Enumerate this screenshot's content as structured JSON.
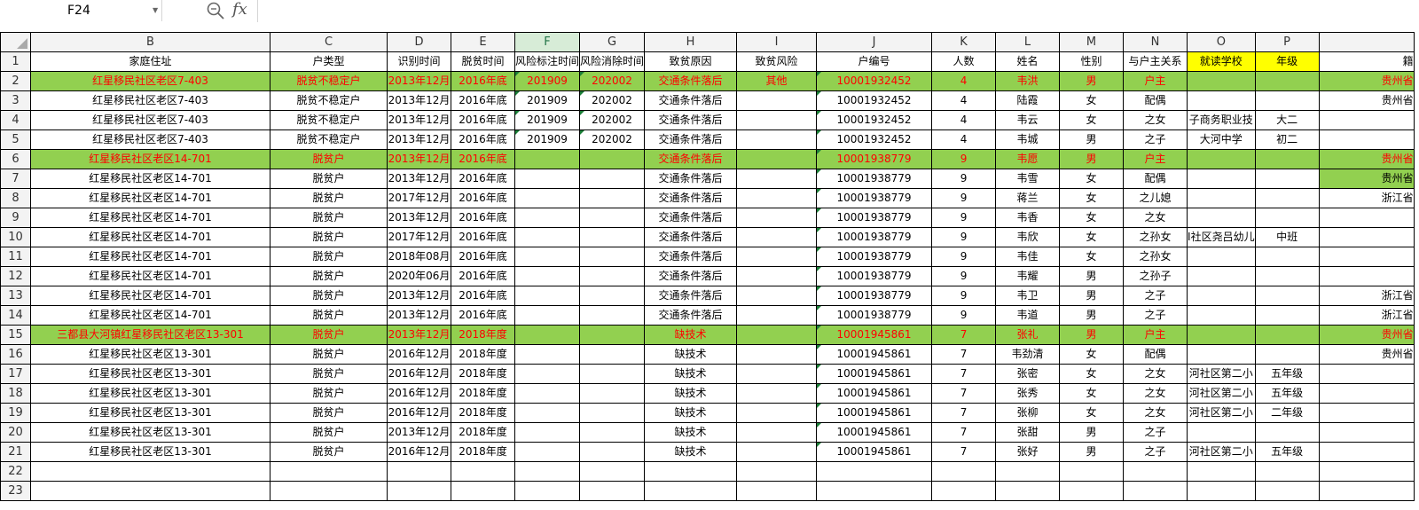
{
  "formula_bar": {
    "cell_ref": "F24",
    "fx_label": "fx",
    "formula": ""
  },
  "columns": [
    "B",
    "C",
    "D",
    "E",
    "F",
    "G",
    "H",
    "I",
    "J",
    "K",
    "L",
    "M",
    "N",
    "O",
    "P",
    ""
  ],
  "header_row": {
    "row": "1",
    "cells": [
      "家庭住址",
      "户类型",
      "识别时间",
      "脱贫时间",
      "风险标注时间",
      "风险消除时间",
      "致贫原因",
      "致贫风险",
      "户编号",
      "人数",
      "姓名",
      "性别",
      "与户主关系",
      "就读学校",
      "年级",
      "籍"
    ]
  },
  "rows": [
    {
      "n": "2",
      "cells": [
        "红星移民社区老区7-403",
        "脱贫不稳定户",
        "2013年12月",
        "2016年底",
        "201909",
        "202002",
        "交通条件落后",
        "其他",
        "10001932452",
        "4",
        "韦洪",
        "男",
        "户主",
        "",
        "",
        "贵州省"
      ]
    },
    {
      "n": "3",
      "cells": [
        "红星移民社区老区7-403",
        "脱贫不稳定户",
        "2013年12月",
        "2016年底",
        "201909",
        "202002",
        "交通条件落后",
        "",
        "10001932452",
        "4",
        "陆霞",
        "女",
        "配偶",
        "",
        "",
        "贵州省"
      ]
    },
    {
      "n": "4",
      "cells": [
        "红星移民社区老区7-403",
        "脱贫不稳定户",
        "2013年12月",
        "2016年底",
        "201909",
        "202002",
        "交通条件落后",
        "",
        "10001932452",
        "4",
        "韦云",
        "女",
        "之女",
        "子商务职业技",
        "大二",
        ""
      ]
    },
    {
      "n": "5",
      "cells": [
        "红星移民社区老区7-403",
        "脱贫不稳定户",
        "2013年12月",
        "2016年底",
        "201909",
        "202002",
        "交通条件落后",
        "",
        "10001932452",
        "4",
        "韦城",
        "男",
        "之子",
        "大河中学",
        "初二",
        ""
      ]
    },
    {
      "n": "6",
      "cells": [
        "红星移民社区老区14-701",
        "脱贫户",
        "2013年12月",
        "2016年底",
        "",
        "",
        "交通条件落后",
        "",
        "10001938779",
        "9",
        "韦愿",
        "男",
        "户主",
        "",
        "",
        "贵州省"
      ]
    },
    {
      "n": "7",
      "cells": [
        "红星移民社区老区14-701",
        "脱贫户",
        "2013年12月",
        "2016年底",
        "",
        "",
        "交通条件落后",
        "",
        "10001938779",
        "9",
        "韦雪",
        "女",
        "配偶",
        "",
        "",
        "贵州省"
      ]
    },
    {
      "n": "8",
      "cells": [
        "红星移民社区老区14-701",
        "脱贫户",
        "2017年12月",
        "2016年底",
        "",
        "",
        "交通条件落后",
        "",
        "10001938779",
        "9",
        "蒋兰",
        "女",
        "之儿媳",
        "",
        "",
        "浙江省"
      ]
    },
    {
      "n": "9",
      "cells": [
        "红星移民社区老区14-701",
        "脱贫户",
        "2013年12月",
        "2016年底",
        "",
        "",
        "交通条件落后",
        "",
        "10001938779",
        "9",
        "韦香",
        "女",
        "之女",
        "",
        "",
        ""
      ]
    },
    {
      "n": "10",
      "cells": [
        "红星移民社区老区14-701",
        "脱贫户",
        "2017年12月",
        "2016年底",
        "",
        "",
        "交通条件落后",
        "",
        "10001938779",
        "9",
        "韦欣",
        "女",
        "之孙女",
        "I社区尧吕幼儿",
        "中班",
        ""
      ]
    },
    {
      "n": "11",
      "cells": [
        "红星移民社区老区14-701",
        "脱贫户",
        "2018年08月",
        "2016年底",
        "",
        "",
        "交通条件落后",
        "",
        "10001938779",
        "9",
        "韦佳",
        "女",
        "之孙女",
        "",
        "",
        ""
      ]
    },
    {
      "n": "12",
      "cells": [
        "红星移民社区老区14-701",
        "脱贫户",
        "2020年06月",
        "2016年底",
        "",
        "",
        "交通条件落后",
        "",
        "10001938779",
        "9",
        "韦耀",
        "男",
        "之孙子",
        "",
        "",
        ""
      ]
    },
    {
      "n": "13",
      "cells": [
        "红星移民社区老区14-701",
        "脱贫户",
        "2013年12月",
        "2016年底",
        "",
        "",
        "交通条件落后",
        "",
        "10001938779",
        "9",
        "韦卫",
        "男",
        "之子",
        "",
        "",
        "浙江省"
      ]
    },
    {
      "n": "14",
      "cells": [
        "红星移民社区老区14-701",
        "脱贫户",
        "2013年12月",
        "2016年底",
        "",
        "",
        "交通条件落后",
        "",
        "10001938779",
        "9",
        "韦道",
        "男",
        "之子",
        "",
        "",
        "浙江省"
      ]
    },
    {
      "n": "15",
      "cells": [
        "三都县大河镇红星移民社区老区13-301",
        "脱贫户",
        "2013年12月",
        "2018年度",
        "",
        "",
        "缺技术",
        "",
        "10001945861",
        "7",
        "张礼",
        "男",
        "户主",
        "",
        "",
        "贵州省"
      ]
    },
    {
      "n": "16",
      "cells": [
        "红星移民社区老区13-301",
        "脱贫户",
        "2016年12月",
        "2018年度",
        "",
        "",
        "缺技术",
        "",
        "10001945861",
        "7",
        "韦劲清",
        "女",
        "配偶",
        "",
        "",
        "贵州省"
      ]
    },
    {
      "n": "17",
      "cells": [
        "红星移民社区老区13-301",
        "脱贫户",
        "2016年12月",
        "2018年度",
        "",
        "",
        "缺技术",
        "",
        "10001945861",
        "7",
        "张密",
        "女",
        "之女",
        "河社区第二小",
        "五年级",
        ""
      ]
    },
    {
      "n": "18",
      "cells": [
        "红星移民社区老区13-301",
        "脱贫户",
        "2016年12月",
        "2018年度",
        "",
        "",
        "缺技术",
        "",
        "10001945861",
        "7",
        "张秀",
        "女",
        "之女",
        "河社区第二小",
        "五年级",
        ""
      ]
    },
    {
      "n": "19",
      "cells": [
        "红星移民社区老区13-301",
        "脱贫户",
        "2016年12月",
        "2018年度",
        "",
        "",
        "缺技术",
        "",
        "10001945861",
        "7",
        "张柳",
        "女",
        "之女",
        "河社区第二小",
        "二年级",
        ""
      ]
    },
    {
      "n": "20",
      "cells": [
        "红星移民社区老区13-301",
        "脱贫户",
        "2013年12月",
        "2018年度",
        "",
        "",
        "缺技术",
        "",
        "10001945861",
        "7",
        "张甜",
        "男",
        "之子",
        "",
        "",
        ""
      ]
    },
    {
      "n": "21",
      "cells": [
        "红星移民社区老区13-301",
        "脱贫户",
        "2016年12月",
        "2018年度",
        "",
        "",
        "缺技术",
        "",
        "10001945861",
        "7",
        "张好",
        "男",
        "之子",
        "河社区第二小",
        "五年级",
        ""
      ]
    }
  ],
  "empty_rows": [
    "22",
    "23"
  ],
  "highlight_rows": [
    "2",
    "6",
    "15"
  ],
  "colors": {
    "highlight_fill": "#92d050",
    "highlight_text": "#ff0000",
    "header_yellow": "#ffff00",
    "selected_col": "#217346"
  }
}
